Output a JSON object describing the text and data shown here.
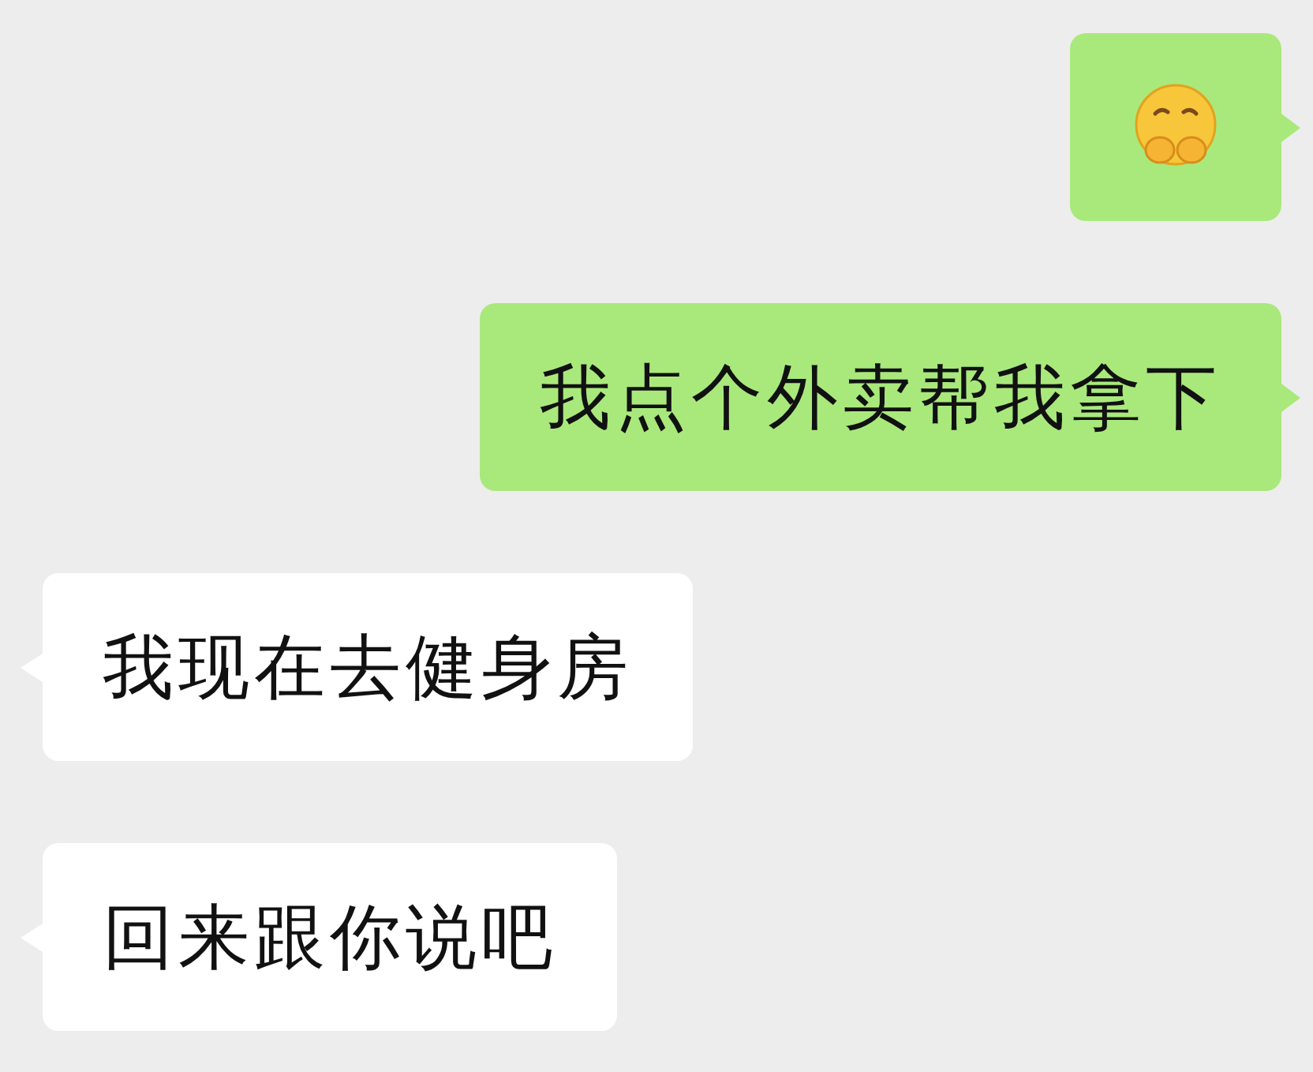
{
  "messages": [
    {
      "kind": "sticker",
      "outgoing": true
    },
    {
      "kind": "text",
      "outgoing": true,
      "text": "我点个外卖帮我拿下"
    },
    {
      "kind": "text",
      "outgoing": false,
      "text": "我现在去健身房"
    },
    {
      "kind": "text",
      "outgoing": false,
      "text": "回来跟你说吧"
    }
  ]
}
